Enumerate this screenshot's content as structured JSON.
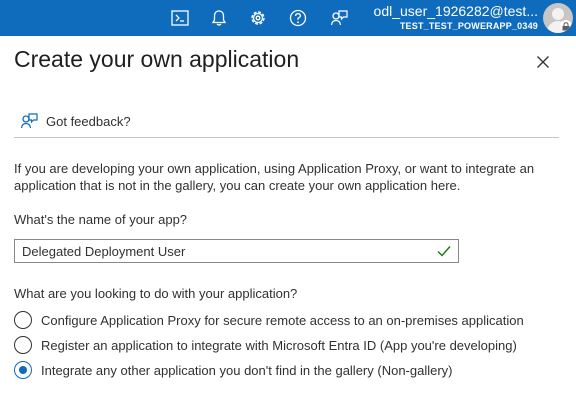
{
  "topbar": {
    "icons": [
      "cloud-shell-icon",
      "notifications-icon",
      "settings-icon",
      "help-icon",
      "feedback-icon"
    ],
    "user": "odl_user_1926282@test...",
    "tenant": "TEST_TEST_POWERAPP_0349"
  },
  "panel": {
    "title": "Create your own application",
    "feedback_label": "Got feedback?",
    "intro": "If you are developing your own application, using Application Proxy, or want to integrate an application that is not in the gallery, you can create your own application here.",
    "name_label": "What's the name of your app?",
    "name_value": "Delegated Deployment User",
    "question": "What are you looking to do with your application?",
    "options": [
      {
        "label": "Configure Application Proxy for secure remote access to an on-premises application",
        "selected": false
      },
      {
        "label": "Register an application to integrate with Microsoft Entra ID (App you're developing)",
        "selected": false
      },
      {
        "label": "Integrate any other application you don't find in the gallery (Non-gallery)",
        "selected": true
      }
    ]
  },
  "colors": {
    "accent": "#0f6cbd",
    "success": "#107c10",
    "text": "#323130"
  }
}
